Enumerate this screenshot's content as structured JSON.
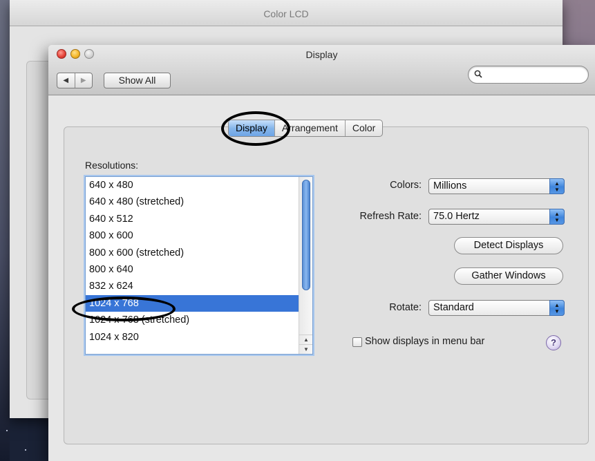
{
  "back_window": {
    "title": "Color LCD"
  },
  "window": {
    "title": "Display",
    "toolbar": {
      "back_glyph": "◀",
      "forward_glyph": "▶",
      "show_all_label": "Show All",
      "search_placeholder": "",
      "search_icon": "search-icon"
    }
  },
  "tabs": [
    {
      "label": "Display",
      "active": true
    },
    {
      "label": "Arrangement",
      "active": false
    },
    {
      "label": "Color",
      "active": false
    }
  ],
  "resolutions": {
    "label": "Resolutions:",
    "items": [
      "640 x 480",
      "640 x 480 (stretched)",
      "640 x 512",
      "800 x 600",
      "800 x 600 (stretched)",
      "800 x 640",
      "832 x 624",
      "1024 x 768",
      "1024 x 768 (stretched)",
      "1024 x 820"
    ],
    "selected": "1024 x 768"
  },
  "settings": {
    "colors_label": "Colors:",
    "colors_value": "Millions",
    "refresh_label": "Refresh Rate:",
    "refresh_value": "75.0 Hertz",
    "detect_button": "Detect Displays",
    "gather_button": "Gather Windows",
    "rotate_label": "Rotate:",
    "rotate_value": "Standard",
    "menu_bar_checkbox": "Show displays in menu bar",
    "menu_bar_checked": false,
    "help_glyph": "?"
  },
  "colors": {
    "selection": "#3875d7",
    "accent": "#6ea5e6",
    "annotation_ring": "#000000"
  }
}
